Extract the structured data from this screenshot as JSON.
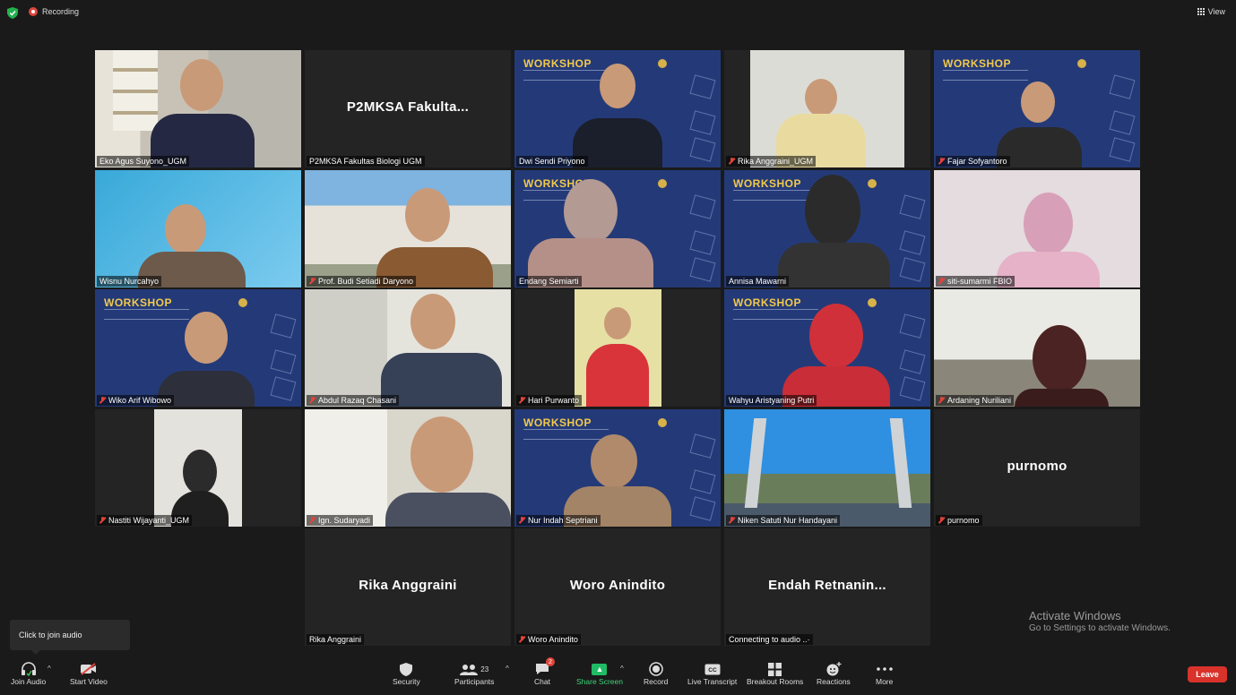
{
  "topbar": {
    "recording_label": "Recording",
    "view_label": "View"
  },
  "participants": [
    {
      "name": "Eko Agus Suyono_UGM",
      "muted": false,
      "video": true
    },
    {
      "name": "P2MKSA Fakultas Biologi UGM",
      "display": "P2MKSA  Fakulta...",
      "muted": false,
      "video": false
    },
    {
      "name": "Dwi Sendi Priyono",
      "muted": false,
      "video": true,
      "background": "workshop"
    },
    {
      "name": "Rika Anggraini_UGM",
      "muted": true,
      "video": true
    },
    {
      "name": "Fajar Sofyantoro",
      "muted": true,
      "video": true,
      "background": "workshop"
    },
    {
      "name": "Wisnu Nurcahyo",
      "muted": false,
      "video": true
    },
    {
      "name": "Prof. Budi Setiadi Daryono",
      "muted": true,
      "video": true
    },
    {
      "name": "Endang Semiarti",
      "muted": false,
      "video": true,
      "background": "workshop"
    },
    {
      "name": "Annisa Mawarni",
      "muted": false,
      "video": true,
      "background": "workshop"
    },
    {
      "name": "siti-sumarmi FBIO",
      "muted": true,
      "video": true
    },
    {
      "name": "Wiko Arif Wibowo",
      "muted": true,
      "video": true,
      "background": "workshop"
    },
    {
      "name": "Abdul Razaq Chasani",
      "muted": true,
      "video": true
    },
    {
      "name": "Hari Purwanto",
      "muted": true,
      "video": true
    },
    {
      "name": "Wahyu Aristyaning Putri",
      "muted": false,
      "video": true,
      "background": "workshop",
      "active_speaker": true
    },
    {
      "name": "Ardaning Nuriliani",
      "muted": true,
      "video": true
    },
    {
      "name": "Nastiti Wijayanti_UGM",
      "muted": true,
      "video": true
    },
    {
      "name": "Ign. Sudaryadi",
      "muted": true,
      "video": true
    },
    {
      "name": "Nur Indah Septriani",
      "muted": true,
      "video": true,
      "background": "workshop"
    },
    {
      "name": "Niken Satuti Nur Handayani",
      "muted": true,
      "video": true
    },
    {
      "name": "purnomo",
      "display": "purnomo",
      "muted": true,
      "video": false
    },
    {
      "name": "Rika Anggraini",
      "display": "Rika Anggraini",
      "muted": false,
      "video": false
    },
    {
      "name": "Woro Anindito",
      "display": "Woro Anindito",
      "muted": true,
      "video": false
    },
    {
      "name": "Connecting to audio ..·",
      "display": "Endah  Retnanin...",
      "muted": false,
      "video": false
    }
  ],
  "workshop_title": "WORKSHOP",
  "tooltip": "Click to join audio",
  "activate_windows": {
    "title": "Activate Windows",
    "subtitle": "Go to Settings to activate Windows."
  },
  "toolbar": {
    "join_audio": "Join Audio",
    "start_video": "Start Video",
    "security": "Security",
    "participants": "Participants",
    "participants_count": "23",
    "chat": "Chat",
    "chat_badge": "2",
    "share_screen": "Share Screen",
    "record": "Record",
    "live_transcript": "Live Transcript",
    "breakout_rooms": "Breakout Rooms",
    "reactions": "Reactions",
    "more": "More",
    "leave": "Leave"
  },
  "colors": {
    "background": "#1a1a1a",
    "tile": "#242424",
    "active_border": "#b8d255",
    "share_green": "#1fbc65",
    "leave_red": "#d8322a",
    "workshop_blue": "#243a78",
    "workshop_yellow": "#f2c94c"
  }
}
